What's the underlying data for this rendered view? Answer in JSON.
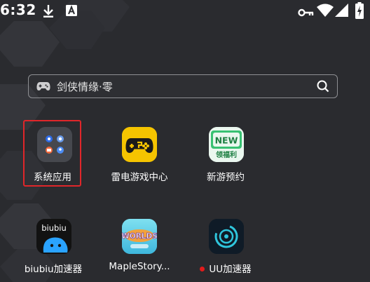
{
  "status_bar": {
    "time": "6:32",
    "left_icons": [
      "download-icon",
      "text-a-icon"
    ],
    "right_icons": [
      "key-icon",
      "wifi-icon",
      "signal-icon",
      "battery-charging-icon"
    ]
  },
  "search": {
    "text": "剑侠情缘·零",
    "leading_icon": "gamepad-icon",
    "trailing_icon": "search-icon"
  },
  "apps": [
    {
      "label": "系统应用",
      "icon": "folder-icon",
      "highlighted": true
    },
    {
      "label": "雷电游戏中心",
      "icon": "gamepad-icon"
    },
    {
      "label": "新游预约",
      "icon": "new-badge-icon",
      "badge_text": "NEW",
      "sub_text": "领福利"
    },
    {
      "label": "biubiu加速器",
      "icon": "biubiu-icon",
      "logo_text": "biubiu"
    },
    {
      "label": "MapleStory...",
      "icon": "maplestory-icon",
      "logo_text": "WORLDS"
    },
    {
      "label": "UU加速器",
      "icon": "uu-icon",
      "has_notification_dot": true
    }
  ],
  "colors": {
    "background": "#2a2b2f",
    "highlight": "#e0262a",
    "leidian_yellow": "#f5c400",
    "new_green": "#38c172",
    "uu_teal": "#2fc6dd"
  }
}
